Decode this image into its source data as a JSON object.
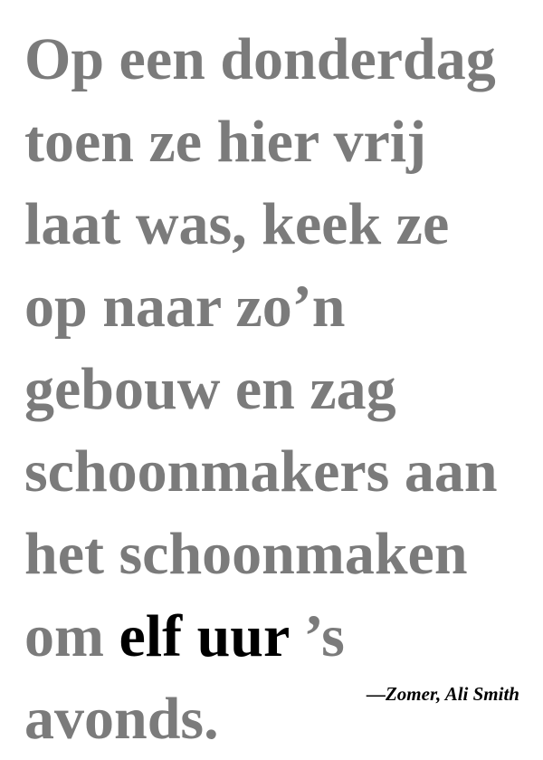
{
  "quote": {
    "lines": [
      "Op een donderdag",
      "toen ze hier vrij",
      "laat was, keek ze",
      "op naar zo’n",
      "gebouw en zag",
      "schoonmakers aan",
      "het schoonmaken"
    ],
    "line8_before": "om ",
    "line8_emphasis": "elf uur",
    "line8_after": " ’s",
    "line9": "avonds.",
    "text_color": "#7b7b7b",
    "emphasis_color": "#000000"
  },
  "attribution": {
    "text": "—Zomer, Ali Smith"
  }
}
